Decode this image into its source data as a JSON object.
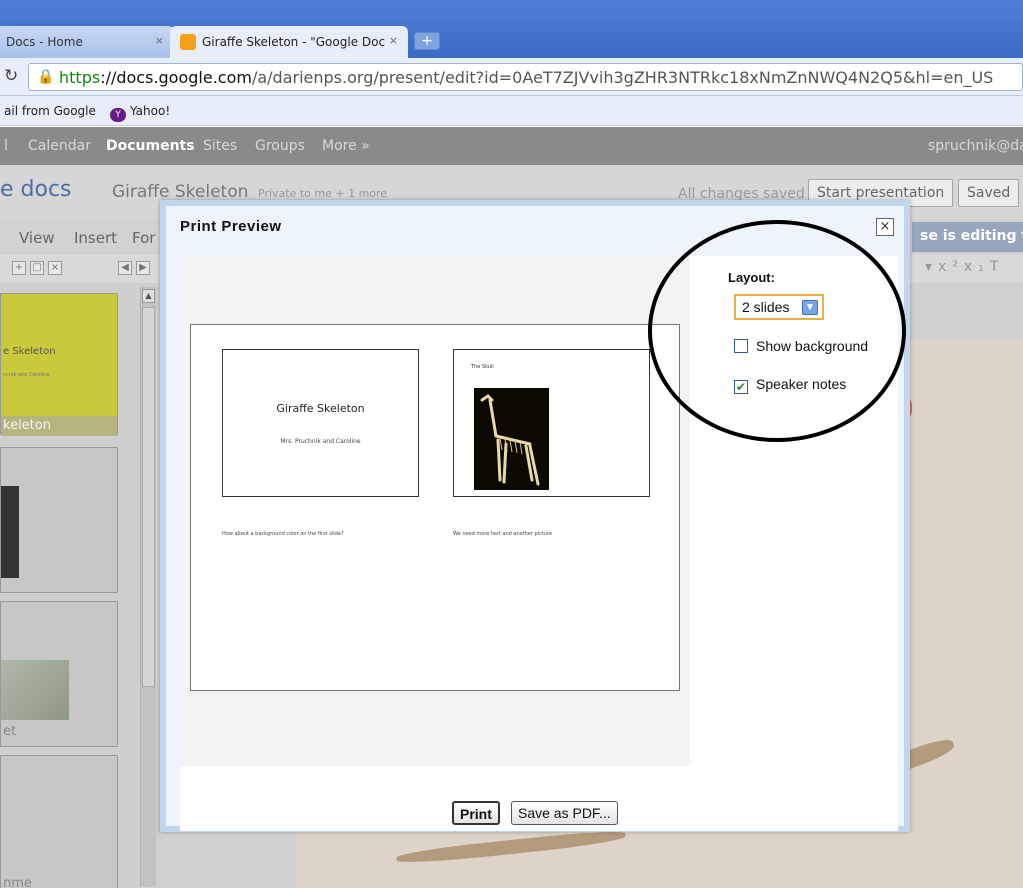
{
  "browser": {
    "tabs": [
      {
        "label": "Docs - Home",
        "close": "×"
      },
      {
        "label": "Giraffe Skeleton - \"Google Doc",
        "close": "×"
      }
    ],
    "new_tab": "+",
    "reload_icon": "reload-icon",
    "url": {
      "protocol": "https",
      "domain": "://docs.google.com",
      "path": "/a/darienps.org/present/edit?id=0AeT7ZJVvih3gZHR3NTRkc18xNmZnNWQ4N2Q5&hl=en_US"
    },
    "bookmarks": [
      {
        "label": "ail from Google"
      },
      {
        "label": "Yahoo!"
      }
    ]
  },
  "gbar": {
    "items": [
      "l",
      "Calendar",
      "Documents",
      "Sites",
      "Groups",
      "More »"
    ],
    "user": "spruchnik@da"
  },
  "docbar": {
    "logo": "e docs",
    "title": "Giraffe Skeleton",
    "sharing": "Private to me + 1 more",
    "saved_status": "All changes saved",
    "start_presentation": "Start presentation",
    "saved_button": "Saved"
  },
  "menubar": {
    "items": [
      "View",
      "Insert",
      "For"
    ],
    "editing_notice": "se is editing th"
  },
  "thumbnails": {
    "slide1_title": "e Skeleton",
    "slide1_sub": "nchik and Caroline",
    "slide1_label": "keleton",
    "slide3_label": "et",
    "slide4_label": "nme"
  },
  "dialog": {
    "title": "Print Preview",
    "close": "×",
    "layout_label": "Layout:",
    "layout_value": "2 slides",
    "show_background_label": "Show background",
    "show_background_checked": false,
    "speaker_notes_label": "Speaker notes",
    "speaker_notes_checked": true,
    "print_button": "Print",
    "save_pdf_button": "Save as PDF...",
    "preview": {
      "slide1_title": "Giraffe Skeleton",
      "slide1_subtitle": "Mrs. Pruchnik and Caroline",
      "slide1_note": "How about a background color on the first slide?",
      "slide2_title": "The Skull",
      "slide2_note": "We need more text and another picture"
    }
  },
  "colors": {
    "tabstrip": "#3a69c4",
    "dialog_border": "#c3d4ef",
    "select_border": "#e8b23c",
    "checkbox_check": "#2a8a2a"
  }
}
